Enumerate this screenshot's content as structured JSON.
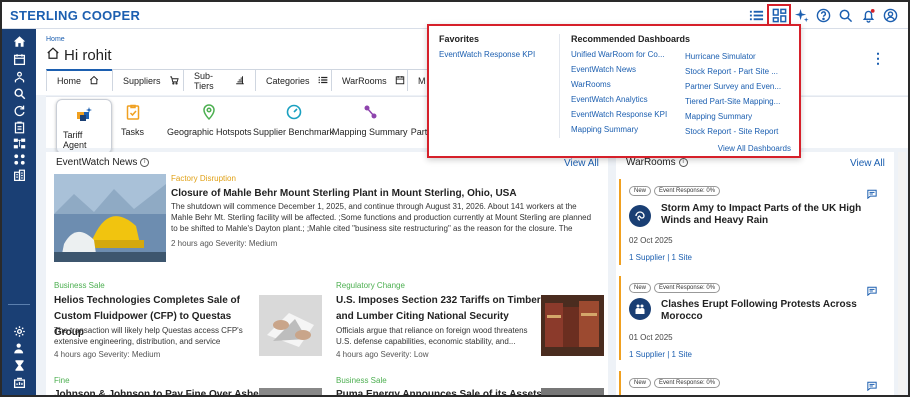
{
  "app": {
    "brand": "STERLING COOPER"
  },
  "header": {
    "breadcrumb": "Home",
    "greeting": "Hi rohit",
    "tabs": [
      {
        "label": "Home"
      },
      {
        "label": "Suppliers"
      },
      {
        "label": "Sub-Tiers"
      },
      {
        "label": "Categories"
      },
      {
        "label": "WarRooms"
      },
      {
        "label": "M"
      }
    ]
  },
  "quick_actions": [
    {
      "label": "Tariff Agent"
    },
    {
      "label": "Tasks"
    },
    {
      "label": "Geographic Hotspots"
    },
    {
      "label": "Supplier Benchmark"
    },
    {
      "label": "Mapping Summary"
    },
    {
      "label": "Part"
    }
  ],
  "news": {
    "title": "EventWatch News",
    "view_all": "View All",
    "featured": {
      "category": "Factory Disruption",
      "title": "Closure of Mahle Behr Mount Sterling Plant in Mount Sterling, Ohio, USA",
      "body": "The shutdown will commence December 1, 2025, and continue through August 31, 2026. About 141 workers at the Mahle Behr Mt. Sterling facility will be affected. ;Some functions and production currently at Mount Sterling are planned to be shifted to Mahle's Dayton plant.; ;Mahle cited \"business site restructuring\" as the reason for the closure. The closure is...",
      "meta": "2 hours ago   Severity: Medium"
    },
    "items": [
      {
        "category": "Business Sale",
        "title": "Helios Technologies Completes Sale of Custom Fluidpower (CFP) to Questas Group",
        "body": "The transaction will likely help Questas access CFP's extensive engineering, distribution, and service network...",
        "meta": "4 hours ago   Severity: Medium"
      },
      {
        "category": "Regulatory Change",
        "title": "U.S. Imposes Section 232 Tariffs on Timber and Lumber Citing National Security",
        "body": "Officials argue that reliance on foreign wood threatens U.S. defense capabilities, economic stability, and...",
        "meta": "4 hours ago   Severity: Low"
      },
      {
        "category": "Fine",
        "title": "Johnson & Johnson to Pay Fine Over Asbestos",
        "body": "",
        "meta": ""
      },
      {
        "category": "Business Sale",
        "title": "Puma Energy Announces Sale of its Assets to",
        "body": "",
        "meta": ""
      }
    ]
  },
  "warrooms": {
    "title": "WarRooms",
    "view_all": "View All",
    "cards": [
      {
        "badge_new": "New",
        "badge_response": "Event Response: 0%",
        "title": "Storm Amy to Impact Parts of the UK High Winds and Heavy Rain",
        "date": "02 Oct 2025",
        "link": "1 Supplier | 1 Site"
      },
      {
        "badge_new": "New",
        "badge_response": "Event Response: 0%",
        "title": "Clashes Erupt Following Protests Across Morocco",
        "date": "01 Oct 2025",
        "link": "1 Supplier | 1 Site"
      },
      {
        "badge_new": "New",
        "badge_response": "Event Response: 0%",
        "title": "",
        "date": "",
        "link": ""
      }
    ]
  },
  "dashboard_menu": {
    "favorites_title": "Favorites",
    "favorites": [
      "EventWatch Response KPI"
    ],
    "recommended_title": "Recommended Dashboards",
    "recommended_col1": [
      "Unified WarRoom for Co...",
      "EventWatch News",
      "WarRooms",
      "EventWatch Analytics",
      "EventWatch Response KPI",
      "Mapping Summary"
    ],
    "recommended_col2": [
      "Hurricane Simulator",
      "Stock Report - Part Site ...",
      "Partner Survey and Even...",
      "Tiered Part-Site Mapping...",
      "Mapping Summary",
      "Stock Report - Site Report"
    ],
    "view_all": "View All Dashboards"
  },
  "colors": {
    "brand": "#1c5fb0",
    "sidebar": "#1a3f74",
    "highlight": "#d6202a",
    "category": "#e0a015",
    "category_green": "#4caf50",
    "warroom_accent": "#f0a020"
  },
  "icons": {
    "topbar": [
      "list-icon",
      "dashboard-grid-icon",
      "sparkle-ai-icon",
      "help-icon",
      "search-icon",
      "bell-icon",
      "user-account-icon"
    ],
    "sidebar": [
      "home-icon",
      "calendar-icon",
      "supplier-icon",
      "search-icon",
      "refresh-icon",
      "clipboard-icon",
      "hierarchy-icon",
      "grid-icon",
      "building-icon",
      "settings-icon",
      "user-admin-icon",
      "hourglass-icon",
      "report-icon"
    ]
  }
}
